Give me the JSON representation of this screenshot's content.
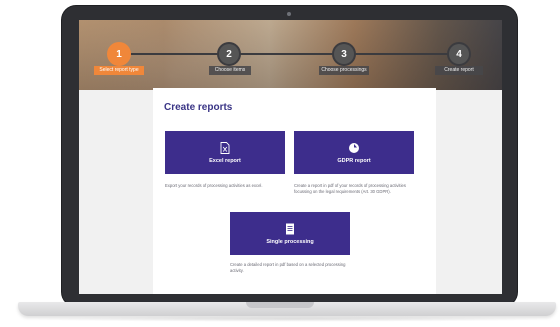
{
  "stepper": {
    "steps": [
      {
        "number": "1",
        "label": "Select report type"
      },
      {
        "number": "2",
        "label": "Choose items"
      },
      {
        "number": "3",
        "label": "Choose processings"
      },
      {
        "number": "4",
        "label": "Create report"
      }
    ],
    "active_step": 1
  },
  "panel": {
    "title": "Create reports"
  },
  "cards": [
    {
      "label": "Excel report",
      "icon": "excel-file-icon",
      "description": "Export your records of processing activities as excel."
    },
    {
      "label": "GDPR report",
      "icon": "gdpr-report-icon",
      "description": "Create a report in pdf of your records of processing activities focussing on the legal requirements (Art. 30 GDPR)."
    },
    {
      "label": "Single processing",
      "icon": "document-icon",
      "description": "Create a detailed report in pdf based on a selected processing activity."
    }
  ],
  "colors": {
    "accent": "#f0873a",
    "card": "#3d2d8c",
    "title": "#3a3586"
  }
}
